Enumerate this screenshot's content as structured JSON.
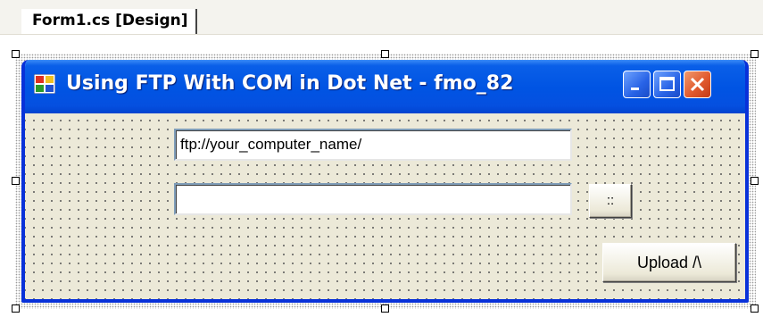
{
  "designer": {
    "tab_label": "Form1.cs [Design]"
  },
  "form": {
    "title": "Using FTP With COM in Dot Net - fmo_82",
    "url_textbox": {
      "value": "ftp://your_computer_name/"
    },
    "file_textbox": {
      "value": ""
    },
    "browse_button_label": "::",
    "upload_button_label": "Upload /\\"
  },
  "colors": {
    "titlebar": "#0054e3",
    "form_background": "#ece9d8",
    "close_button": "#e15a2e"
  },
  "icons": {
    "app": "form-app-icon",
    "minimize": "minimize-icon",
    "maximize": "maximize-icon",
    "close": "close-icon"
  }
}
